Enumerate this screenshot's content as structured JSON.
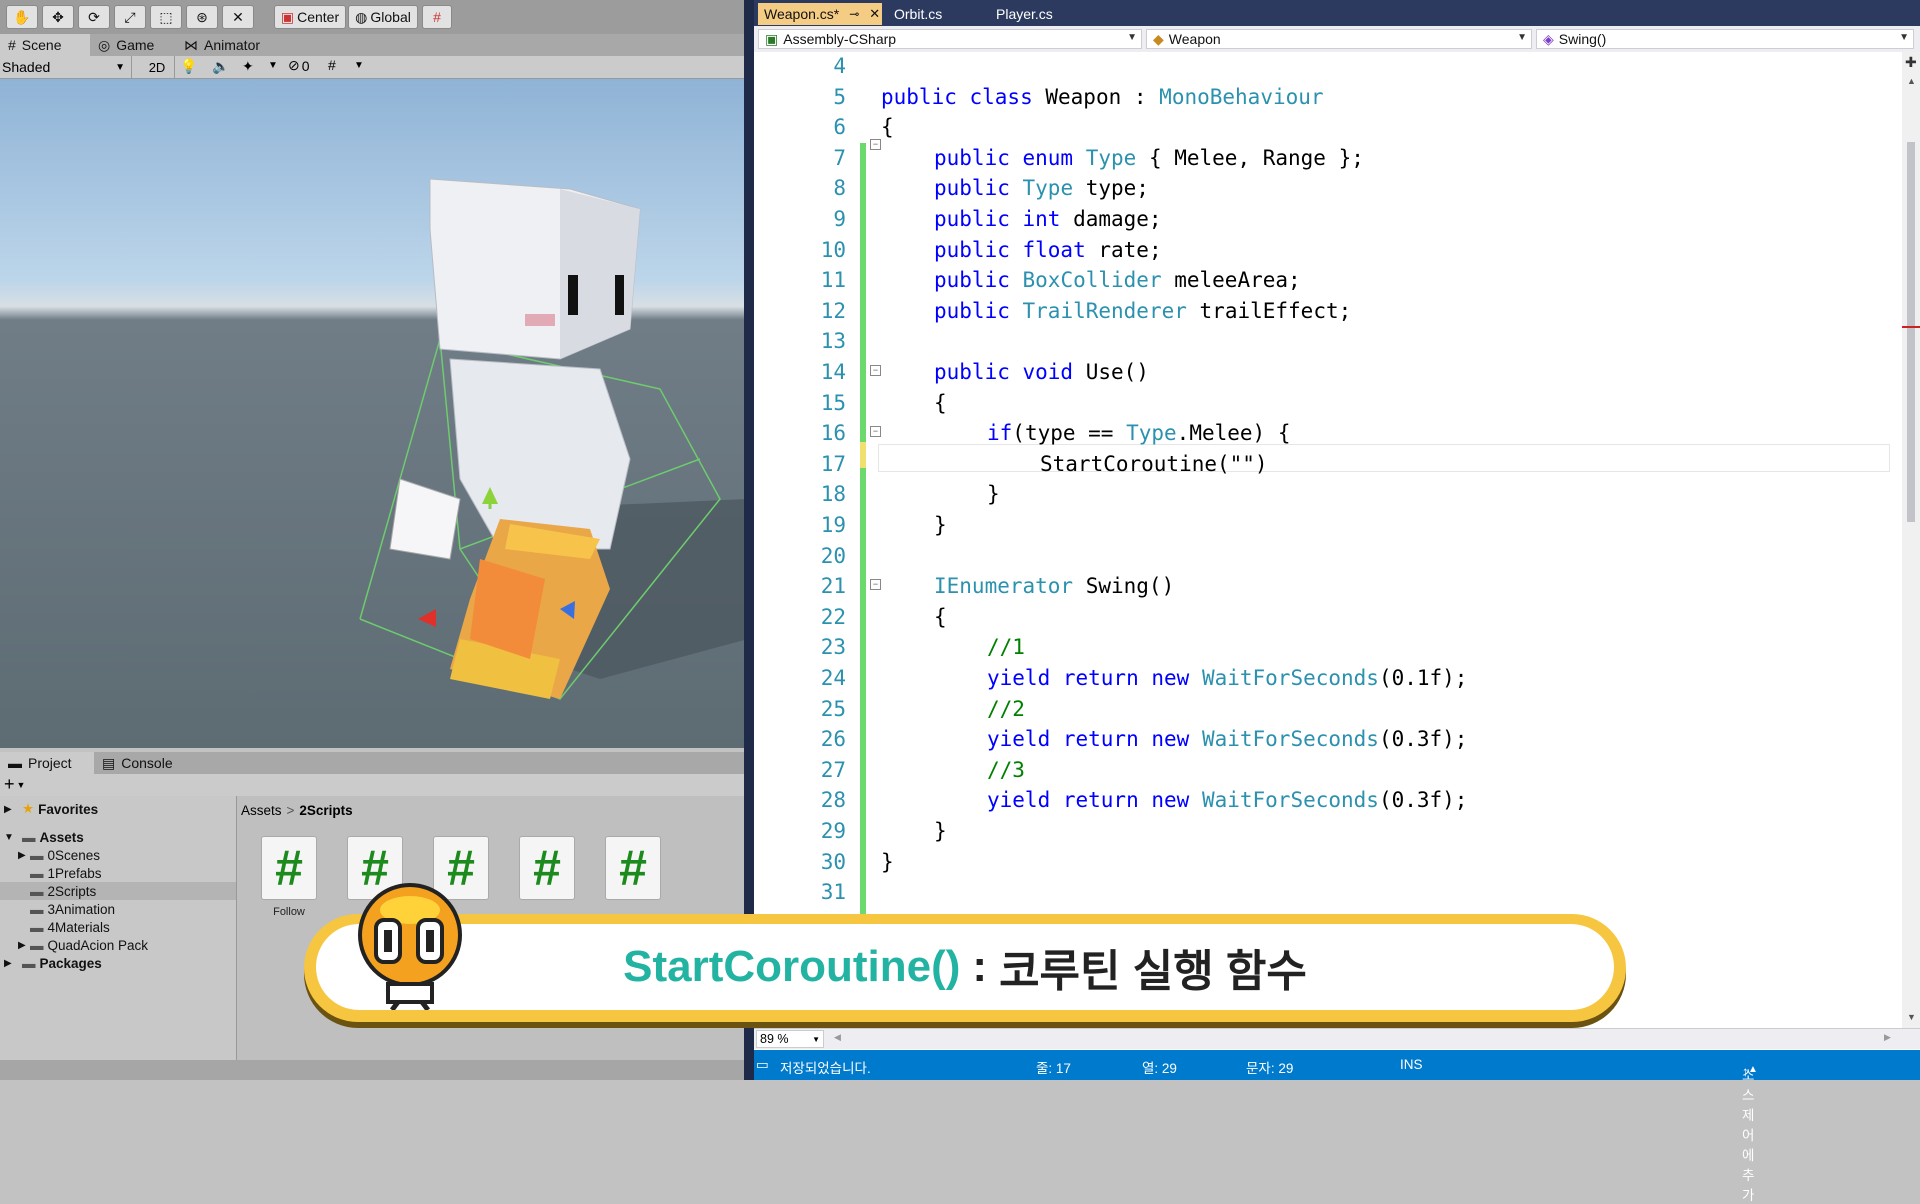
{
  "unity": {
    "toolbar": {
      "center": "Center",
      "global": "Global"
    },
    "tabs": {
      "scene": "Scene",
      "game": "Game",
      "animator": "Animator"
    },
    "scene_toolbar": {
      "shading": "Shaded",
      "mode_2d": "2D",
      "hidden_count": "0"
    },
    "bottom_tabs": {
      "project": "Project",
      "console": "Console"
    },
    "add_button": "+",
    "tree": {
      "favorites": "Favorites",
      "assets": "Assets",
      "folders": [
        "0Scenes",
        "1Prefabs",
        "2Scripts",
        "3Animation",
        "4Materials",
        "QuadAcion Pack"
      ],
      "packages": "Packages"
    },
    "breadcrumb": {
      "root": "Assets",
      "sep": ">",
      "current": "2Scripts"
    },
    "asset_icon_symbol": "#",
    "asset_labels": [
      "Follow",
      "",
      "",
      "",
      ""
    ]
  },
  "vs": {
    "tabs": [
      {
        "label": "Weapon.cs*",
        "pin": "⊸",
        "close": "✕"
      },
      {
        "label": "Orbit.cs"
      },
      {
        "label": "Player.cs"
      }
    ],
    "nav": {
      "project": "Assembly-CSharp",
      "class": "Weapon",
      "member": "Swing()"
    },
    "line_numbers": [
      "4",
      "5",
      "6",
      "7",
      "8",
      "9",
      "10",
      "11",
      "12",
      "13",
      "14",
      "15",
      "16",
      "17",
      "18",
      "19",
      "20",
      "21",
      "22",
      "23",
      "24",
      "25",
      "26",
      "27",
      "28",
      "29",
      "30",
      "31"
    ],
    "code": {
      "l5": [
        "public class ",
        "Weapon",
        " : ",
        "MonoBehaviour"
      ],
      "l6": "{",
      "l7": [
        "public enum ",
        "Type",
        " { Melee, Range };"
      ],
      "l8": [
        "public ",
        "Type",
        " type;"
      ],
      "l9": [
        "public int ",
        "damage;"
      ],
      "l10": [
        "public float ",
        "rate;"
      ],
      "l11": [
        "public ",
        "BoxCollider",
        " meleeArea;"
      ],
      "l12": [
        "public ",
        "TrailRenderer",
        " trailEffect;"
      ],
      "l14": [
        "public void ",
        "Use()"
      ],
      "l15": "{",
      "l16": [
        "if",
        "(type == ",
        "Type",
        ".Melee) {"
      ],
      "l17": "StartCoroutine(\"\")",
      "l18": "}",
      "l19": "}",
      "l21": [
        "IEnumerator",
        " Swing()"
      ],
      "l22": "{",
      "l23": "//1",
      "l24": [
        "yield return new ",
        "WaitForSeconds",
        "(0.1f);"
      ],
      "l25": "//2",
      "l26": [
        "yield return new ",
        "WaitForSeconds",
        "(0.3f);"
      ],
      "l27": "//3",
      "l28": [
        "yield return new ",
        "WaitForSeconds",
        "(0.3f);"
      ],
      "l29": "}",
      "l30": "}"
    },
    "zoom": "89 %",
    "status": {
      "saved": "저장되었습니다.",
      "line": "줄: 17",
      "col": "열: 29",
      "ch": "문자: 29",
      "mode": "INS",
      "source_control": "소스 제어에 추가"
    }
  },
  "caption": {
    "term": "StartCoroutine()",
    "colon": ":",
    "desc": "코루틴 실행 함수"
  },
  "colors": {
    "keyword": "#0000ff",
    "type": "#2b91af",
    "comment": "#008000",
    "caption_term": "#23b3a2",
    "caption_border": "#f7c640",
    "vs_status": "#007acc"
  }
}
